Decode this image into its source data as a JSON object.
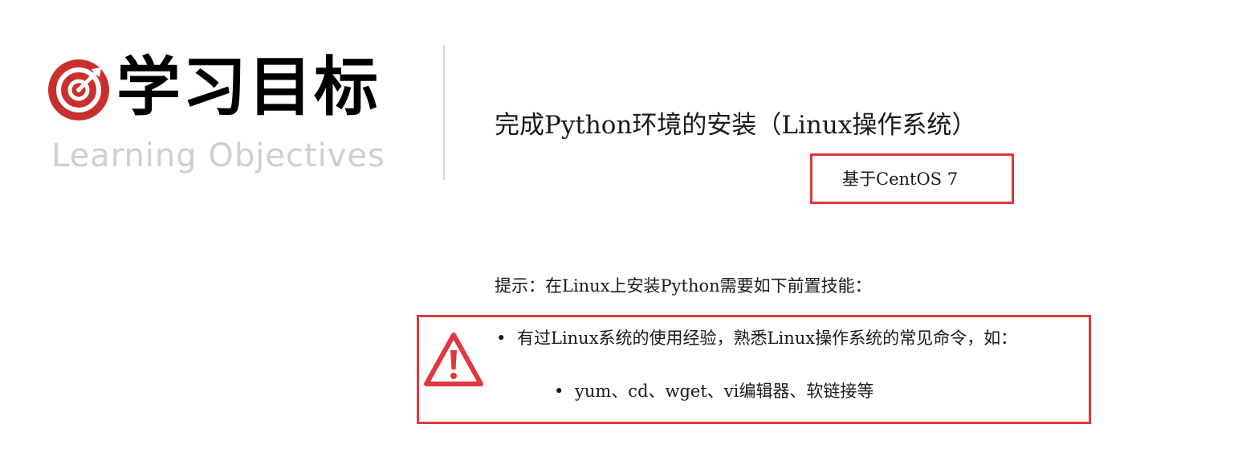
{
  "header": {
    "icon": "target-icon",
    "title_cn": "学习目标",
    "title_en": "Learning Objectives"
  },
  "content": {
    "main_goal": "完成Python环境的安装（Linux操作系统）",
    "platform_note": "基于CentOS 7",
    "hint": "提示：在Linux上安装Python需要如下前置技能：",
    "warning_icon": "warning-triangle-icon",
    "prerequisites": {
      "item": "有过Linux系统的使用经验，熟悉Linux操作系统的常见命令，如：",
      "sub_item": "yum、cd、wget、vi编辑器、软链接等",
      "bullet": "•"
    }
  },
  "colors": {
    "accent_red": "#e0383e",
    "icon_red": "#c9302c",
    "subtitle_gray": "#cfcfcf",
    "divider_gray": "#d6d6d6"
  }
}
